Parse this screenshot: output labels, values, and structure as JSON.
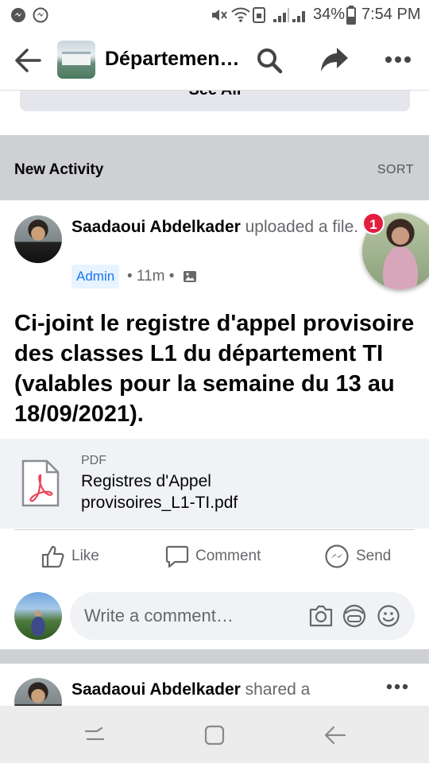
{
  "status_bar": {
    "battery_percent": "34%",
    "time": "7:54 PM",
    "icons": [
      "messenger-bubble-icon",
      "messenger-icon",
      "mute-icon",
      "wifi-icon",
      "signal-icon",
      "battery-icon"
    ]
  },
  "app_bar": {
    "title": "Départemen…",
    "icons": [
      "back-arrow-icon",
      "search-icon",
      "share-icon",
      "more-icon"
    ]
  },
  "see_all": {
    "label": "See All"
  },
  "section": {
    "title": "New Activity",
    "sort_label": "SORT"
  },
  "post": {
    "author": "Saadaoui Abdelkader",
    "action": " uploaded a file.",
    "role_badge": "Admin",
    "time": "• 11m •",
    "notification_count": "1",
    "text": "Ci-joint le registre d'appel provisoire des classes L1 du département TI (valables pour la semaine du 13 au 18/09/2021).",
    "attachment": {
      "type": "PDF",
      "name": "Registres d'Appel provisoires_L1-TI.pdf"
    },
    "actions": {
      "like": "Like",
      "comment": "Comment",
      "send": "Send"
    },
    "comment_placeholder": "Write a comment…"
  },
  "next_post": {
    "author": "Saadaoui Abdelkader",
    "action": " shared a"
  },
  "colors": {
    "accent": "#1877f2",
    "section_bg": "#ced0d4",
    "badge_red": "#e41e3f"
  }
}
